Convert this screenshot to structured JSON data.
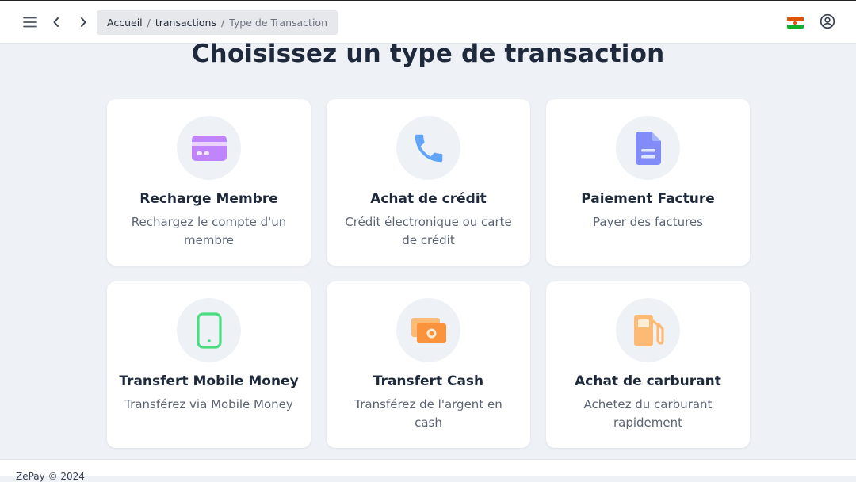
{
  "header": {
    "menu_icon": "menu-icon",
    "back_icon": "chevron-left-icon",
    "forward_icon": "chevron-right-icon",
    "breadcrumb": {
      "home": "Accueil",
      "separator": "/",
      "section": "transactions",
      "current": "Type de Transaction"
    },
    "language_flag": "niger-flag-icon",
    "account_icon": "user-circle-icon"
  },
  "main": {
    "title": "Choisissez un type de transaction",
    "cards": [
      {
        "title": "Recharge Membre",
        "description": "Rechargez le compte d'un membre",
        "icon": "credit-card-icon",
        "color": "#c084fc"
      },
      {
        "title": "Achat de crédit",
        "description": "Crédit électronique ou carte de crédit",
        "icon": "phone-icon",
        "color": "#60a5fa"
      },
      {
        "title": "Paiement Facture",
        "description": "Payer des factures",
        "icon": "document-icon",
        "color": "#818cf8"
      },
      {
        "title": "Transfert Mobile Money",
        "description": "Transférez via Mobile Money",
        "icon": "mobile-phone-icon",
        "color": "#4ade80"
      },
      {
        "title": "Transfert Cash",
        "description": "Transférez de l'argent en cash",
        "icon": "cash-icon",
        "color": "#fb923c"
      },
      {
        "title": "Achat de carburant",
        "description": "Achetez du carburant rapidement",
        "icon": "fuel-pump-icon",
        "color": "#fdba74"
      }
    ]
  },
  "footer": {
    "text": "ZePay © 2024"
  }
}
